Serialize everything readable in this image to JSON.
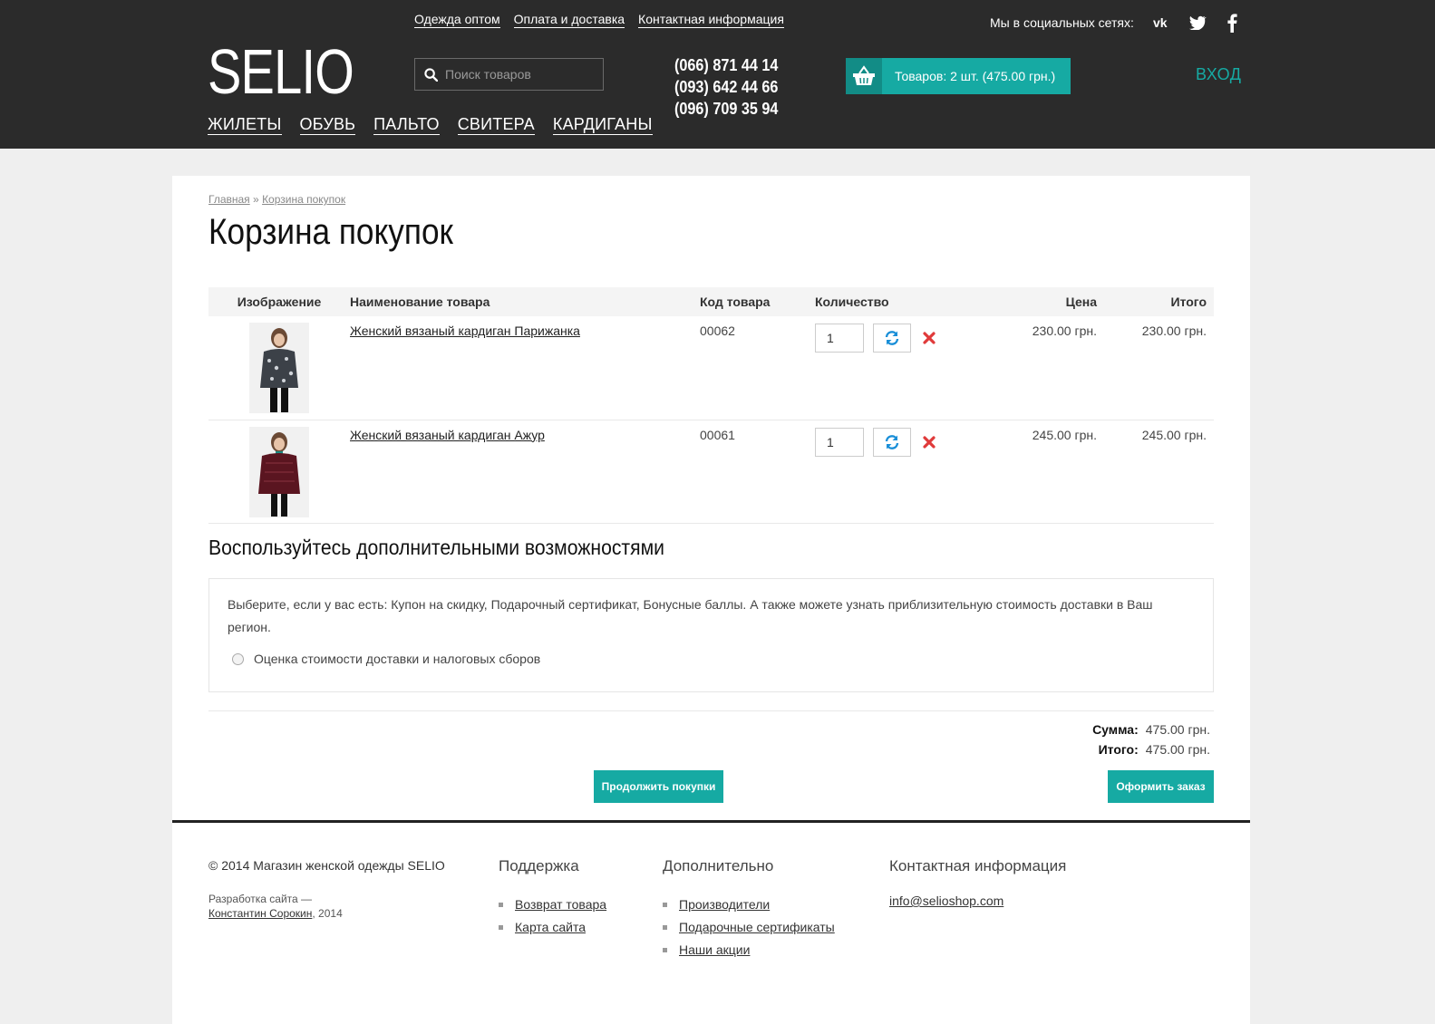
{
  "header": {
    "logo": "SELIO",
    "top_links": [
      "Одежда оптом",
      "Оплата и доставка",
      "Контактная информация"
    ],
    "search_placeholder": "Поиск товаров",
    "phones": [
      "(066) 871 44 14",
      "(093) 642 44 66",
      "(096) 709 35 94"
    ],
    "cart_label": "Товаров: 2 шт. (475.00 грн.)",
    "social_label": "Мы в социальных сетях:",
    "social_icons": [
      "vk-icon",
      "twitter-icon",
      "facebook-icon"
    ],
    "login": "ВХОД",
    "nav": [
      "ЖИЛЕТЫ",
      "ОБУВЬ",
      "ПАЛЬТО",
      "СВИТЕРА",
      "КАРДИГАНЫ"
    ]
  },
  "breadcrumb": {
    "home": "Главная",
    "separator": "»",
    "current": "Корзина покупок"
  },
  "page_title": "Корзина покупок",
  "table": {
    "headers": {
      "image": "Изображение",
      "name": "Наименование товара",
      "code": "Код товара",
      "qty": "Количество",
      "price": "Цена",
      "total": "Итого"
    },
    "rows": [
      {
        "name": "Женский вязаный кардиган Парижанка",
        "code": "00062",
        "qty": "1",
        "price": "230.00 грн.",
        "total": "230.00 грн."
      },
      {
        "name": "Женский вязаный кардиган Ажур",
        "code": "00061",
        "qty": "1",
        "price": "245.00 грн.",
        "total": "245.00 грн."
      }
    ]
  },
  "options": {
    "title": "Воспользуйтесь дополнительными возможностями",
    "text": "Выберите, если у вас есть: Купон на скидку, Подарочный сертификат, Бонусные баллы. А также можете узнать приблизительную стоимость доставки в Ваш регион.",
    "radio_label": "Оценка стоимости доставки и налоговых сборов"
  },
  "totals": {
    "sum_label": "Сумма:",
    "sum_value": "475.00 грн.",
    "total_label": "Итого:",
    "total_value": "475.00 грн."
  },
  "buttons": {
    "continue": "Продолжить покупки",
    "checkout": "Оформить заказ"
  },
  "footer": {
    "copyright": "© 2014 Магазин женской одежды SELIO",
    "dev_prefix": "Разработка сайта —",
    "dev_name": "Константин Сорокин",
    "dev_year": ", 2014",
    "support": {
      "title": "Поддержка",
      "items": [
        "Возврат товара",
        "Карта сайта"
      ]
    },
    "extra": {
      "title": "Дополнительно",
      "items": [
        "Производители",
        "Подарочные сертификаты",
        "Наши акции"
      ]
    },
    "contact": {
      "title": "Контактная информация",
      "email": "info@selioshop.com"
    }
  },
  "colors": {
    "accent": "#16aaa3",
    "header_bg": "#2b2b2b",
    "remove": "#e03a3a",
    "refresh": "#1a8fd8"
  }
}
